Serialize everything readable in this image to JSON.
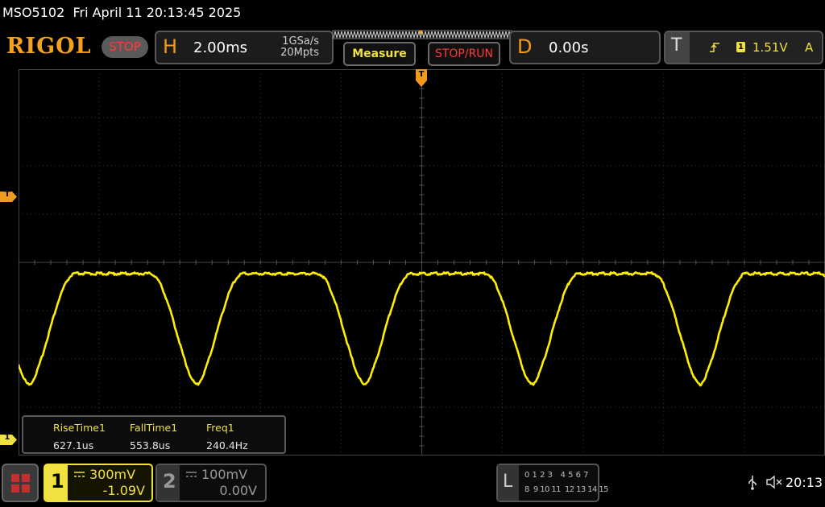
{
  "title": "MSO5102  Fri April 11 20:13:45 2025",
  "brand": "RIGOL",
  "run_state": "STOP",
  "horizontal": {
    "letter": "H",
    "timebase": "2.00ms",
    "sample_rate": "1GSa/s",
    "memory_depth": "20Mpts"
  },
  "buttons": {
    "measure": "Measure",
    "stop_run": "STOP/RUN"
  },
  "delay": {
    "letter": "D",
    "value": "0.00s"
  },
  "trigger": {
    "letter": "T",
    "source": "1",
    "level": "1.51V",
    "mode": "A"
  },
  "markers": {
    "trigger_top": "T",
    "trigger_level": "T",
    "channel1": "1"
  },
  "measurements": [
    {
      "label": "RiseTime1",
      "value": "627.1us"
    },
    {
      "label": "FallTime1",
      "value": "553.8us"
    },
    {
      "label": "Freq1",
      "value": "240.4Hz"
    }
  ],
  "channel1": {
    "number": "1",
    "scale": "300mV",
    "offset": "-1.09V",
    "coupling_icon": "dc-coupling-icon",
    "color": "#ffee00"
  },
  "channel2": {
    "number": "2",
    "scale": "100mV",
    "offset": "0.00V",
    "coupling_icon": "dc-coupling-icon",
    "color": "#7a7a7a"
  },
  "logic": {
    "letter": "L",
    "row1": "0 1 2 3   4 5 6 7",
    "row2": "8  9 10 11  12 13 14 15"
  },
  "clock": "20:13",
  "colors": {
    "accent": "#f39a1e",
    "trace": "#ffee00",
    "stop": "#ff3a3a",
    "grid": "#3a3a3a"
  }
}
